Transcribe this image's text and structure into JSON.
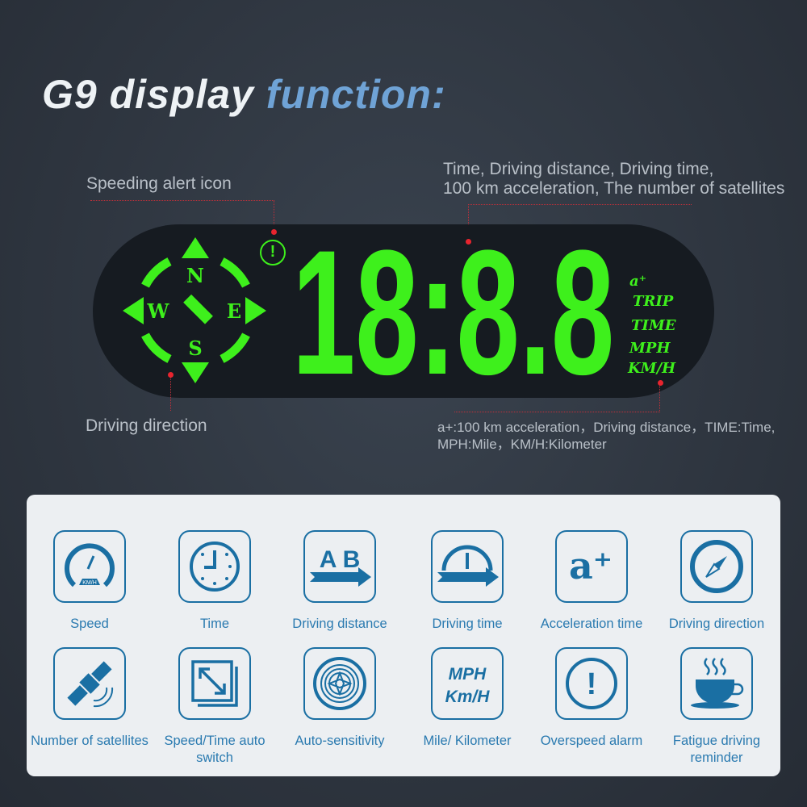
{
  "title": {
    "part1": "G9 display",
    "part2": "function:"
  },
  "callouts": {
    "speeding": "Speeding alert icon",
    "top_right_1": "Time, Driving distance, Driving time,",
    "top_right_2": "100 km acceleration, The number of satellites",
    "direction": "Driving direction",
    "bottom_right_1": "a+:100 km acceleration，Driving distance，TIME:Time,",
    "bottom_right_2": "MPH:Mile，KM/H:Kilometer"
  },
  "display": {
    "compass": {
      "n": "N",
      "s": "S",
      "e": "E",
      "w": "W"
    },
    "digits": "18:8.8",
    "units": [
      "a⁺",
      "TRIP",
      "TIME",
      "MPH",
      "KM/H"
    ],
    "alert_glyph": "!",
    "color": "#3ef01c"
  },
  "features": [
    {
      "label": "Speed",
      "icon": "speedometer-icon",
      "sub": "KM/H"
    },
    {
      "label": "Time",
      "icon": "clock-icon"
    },
    {
      "label": "Driving distance",
      "icon": "a-to-b-icon",
      "sub": "A B"
    },
    {
      "label": "Driving time",
      "icon": "timer-arrow-icon"
    },
    {
      "label": "Acceleration time",
      "icon": "a-plus-icon",
      "sub": "a⁺"
    },
    {
      "label": "Driving direction",
      "icon": "compass-icon"
    },
    {
      "label": "Number of satellites",
      "icon": "satellite-icon"
    },
    {
      "label": "Speed/Time auto switch",
      "icon": "resize-arrows-icon"
    },
    {
      "label": "Auto-sensitivity",
      "icon": "aperture-icon"
    },
    {
      "label": "Mile/ Kilometer",
      "icon": "mph-kmh-icon",
      "sub": "MPH",
      "sub2": "Km/H"
    },
    {
      "label": "Overspeed alarm",
      "icon": "alert-icon",
      "sub": "!"
    },
    {
      "label": "Fatigue driving reminder",
      "icon": "coffee-cup-icon"
    }
  ],
  "colors": {
    "accent_blue": "#1a6fa3",
    "label_blue": "#2a7ab0",
    "panel": "#eceff2",
    "lcd_green": "#3ef01c"
  }
}
